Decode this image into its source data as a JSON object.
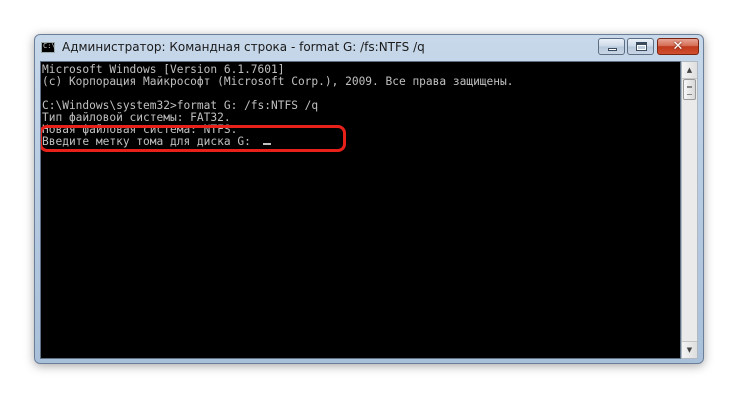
{
  "window": {
    "title": "Администратор: Командная строка - format  G: /fs:NTFS /q",
    "minimize_icon": "minimize-icon",
    "maximize_icon": "maximize-icon",
    "close_icon": "close-icon",
    "close_glyph": "✕"
  },
  "console": {
    "lines": [
      "Microsoft Windows [Version 6.1.7601]",
      "(c) Корпорация Майкрософт (Microsoft Corp.), 2009. Все права защищены.",
      "",
      "C:\\Windows\\system32>format G: /fs:NTFS /q",
      "Тип файловой системы: FAT32.",
      "Новая файловая система: NTFS.",
      "Введите метку тома для диска G: "
    ],
    "highlight_color": "#e8201a",
    "text_color": "#c0c0c0",
    "background_color": "#000000"
  },
  "scrollbar": {
    "up_arrow": "▲",
    "down_arrow": "▼"
  }
}
